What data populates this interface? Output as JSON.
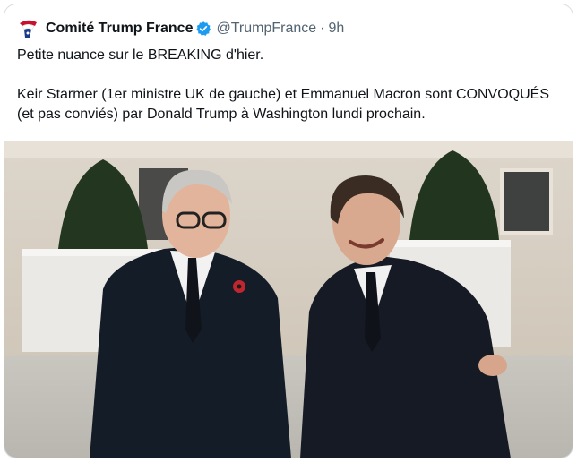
{
  "tweet": {
    "author_name": "Comité Trump France",
    "handle": "@TrumpFrance",
    "separator": "·",
    "time": "9h",
    "text_line1": "Petite nuance sur le BREAKING d'hier.",
    "text_line2": "Keir Starmer (1er ministre UK de gauche) et Emmanuel Macron sont CONVOQUÉS (et pas conviés) par Donald Trump à Washington lundi prochain.",
    "avatar_icon": "trump-profile-logo-icon",
    "verified_icon": "verified-badge-icon",
    "verified_color": "#1d9bf0"
  },
  "media": {
    "description_icon": "photo"
  }
}
